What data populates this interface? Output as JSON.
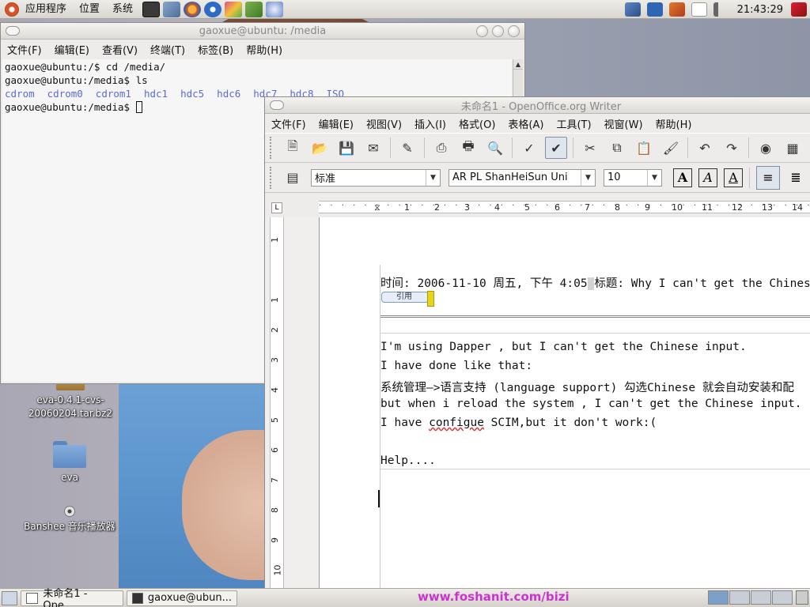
{
  "top_panel": {
    "menus": [
      "应用程序",
      "位置",
      "系统"
    ],
    "clock": "21:43:29",
    "icons": [
      "ubuntu-logo",
      "terminal-launcher",
      "network-launcher",
      "firefox-launcher",
      "thunderbird-launcher",
      "paint-launcher",
      "dictionary-launcher",
      "update-launcher",
      "network-tray",
      "removable-drive-tray",
      "user-tray",
      "printer-tray",
      "volume-tray",
      "logout-tray"
    ]
  },
  "desktop_icons": [
    {
      "label": "eva-0.4.1-cvs-\n20060204.tar.bz2",
      "icon": "archive-icon"
    },
    {
      "label": "eva",
      "icon": "folder-icon"
    },
    {
      "label": "Banshee 音乐播放器",
      "icon": "music-player-icon"
    }
  ],
  "terminal": {
    "title": "gaoxue@ubuntu: /media",
    "menus": [
      "文件(F)",
      "编辑(E)",
      "查看(V)",
      "终端(T)",
      "标签(B)",
      "帮助(H)"
    ],
    "lines": [
      "gaoxue@ubuntu:/$ cd /media/",
      "gaoxue@ubuntu:/media$ ls"
    ],
    "ls_items": [
      "cdrom",
      "cdrom0",
      "cdrom1",
      "hdc1",
      "hdc5",
      "hdc6",
      "hdc7",
      "hdc8",
      "ISO"
    ],
    "prompt": "gaoxue@ubuntu:/media$ "
  },
  "writer": {
    "title": "未命名1 - OpenOffice.org Writer",
    "menus": [
      "文件(F)",
      "编辑(E)",
      "视图(V)",
      "插入(I)",
      "格式(O)",
      "表格(A)",
      "工具(T)",
      "视窗(W)",
      "帮助(H)"
    ],
    "paragraph_style": "标准",
    "font_name": "AR PL ShanHeiSun Uni",
    "font_size": "10",
    "ruler_ticks": [
      "1",
      "2",
      "3",
      "4",
      "5",
      "6",
      "7",
      "8",
      "9",
      "10",
      "11",
      "12",
      "13",
      "14"
    ],
    "vruler_ticks": [
      "1",
      "1",
      "2",
      "3",
      "4",
      "5",
      "6",
      "7",
      "8",
      "9",
      "10"
    ],
    "document": {
      "header_time": "时间: 2006-11-10 周五, 下午 4:05",
      "header_title": "标题: Why I can't get the Chinese in",
      "quote_label": "引用",
      "lines": [
        "I'm using Dapper , but I can't get the Chinese input.",
        "I have done like that:",
        "系统管理—>语言支持 (language support) 勾选Chinese 就会自动安装和配",
        "but when i reload the system , I can't get the Chinese input."
      ],
      "line_configue_before": "I have ",
      "line_configue_word": "configue",
      "line_configue_after": " SCIM,but it don't work:(",
      "help_line": "Help...."
    }
  },
  "bottom_panel": {
    "tasks": [
      "未命名1 - Ope...",
      "gaoxue@ubun..."
    ],
    "watermark": "www.foshanit.com/bizi"
  }
}
